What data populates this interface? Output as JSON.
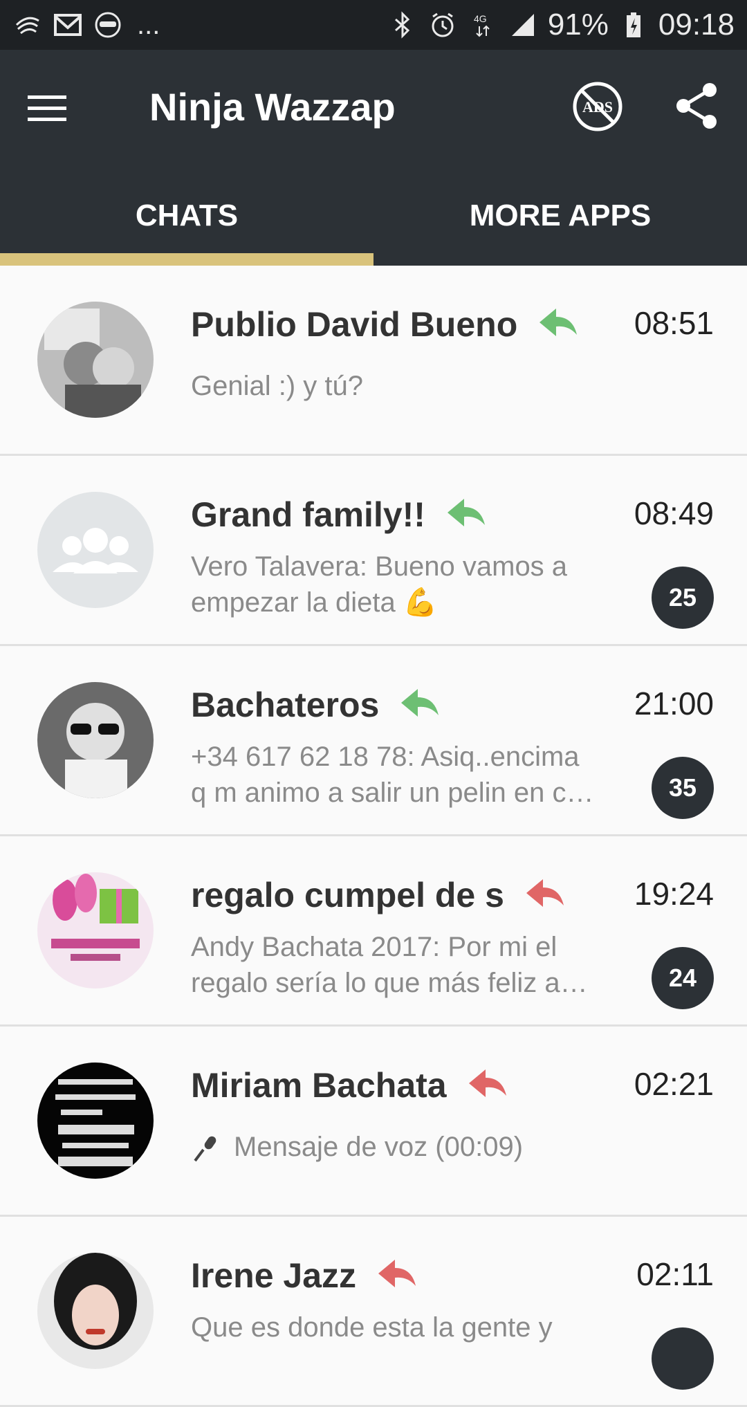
{
  "status_bar": {
    "more": "...",
    "battery": "91%",
    "clock": "09:18"
  },
  "app_bar": {
    "title": "Ninja Wazzap"
  },
  "tabs": [
    {
      "label": "CHATS",
      "active": true
    },
    {
      "label": "MORE APPS",
      "active": false
    }
  ],
  "chats": [
    {
      "name": "Publio David Bueno",
      "time": "08:51",
      "message": [
        "Genial :) y tú?"
      ],
      "reply_color": "#6dbf73",
      "badge": ""
    },
    {
      "name": "Grand family!!",
      "time": "08:49",
      "message": [
        "Vero Talavera: Bueno vamos a",
        "empezar la dieta 💪"
      ],
      "reply_color": "#6dbf73",
      "badge": "25"
    },
    {
      "name": "Bachateros",
      "time": "21:00",
      "message": [
        "+34 617 62 18 78: Asiq..encima",
        "q m animo a salir un pelin en c…"
      ],
      "reply_color": "#6dbf73",
      "badge": "35"
    },
    {
      "name": "regalo cumpel de s",
      "time": "19:24",
      "message": [
        "Andy Bachata 2017: Por mi el",
        "regalo sería lo que más feliz a…"
      ],
      "reply_color": "#e06666",
      "badge": "24"
    },
    {
      "name": "Miriam Bachata",
      "time": "02:21",
      "message": [
        "Mensaje de voz (00:09)"
      ],
      "reply_color": "#e06666",
      "badge": ""
    },
    {
      "name": "Irene Jazz",
      "time": "02:11",
      "message": [
        "Que es donde esta la gente y"
      ],
      "reply_color": "#e06666",
      "badge": ""
    }
  ],
  "colors": {
    "app_bar": "#2c3136",
    "tab_indicator": "#d9c37c",
    "badge": "#2c3136"
  },
  "icons": [
    "hamburger-menu-icon",
    "no-ads-icon",
    "share-icon",
    "reply-icon",
    "group-icon",
    "mic-icon"
  ]
}
